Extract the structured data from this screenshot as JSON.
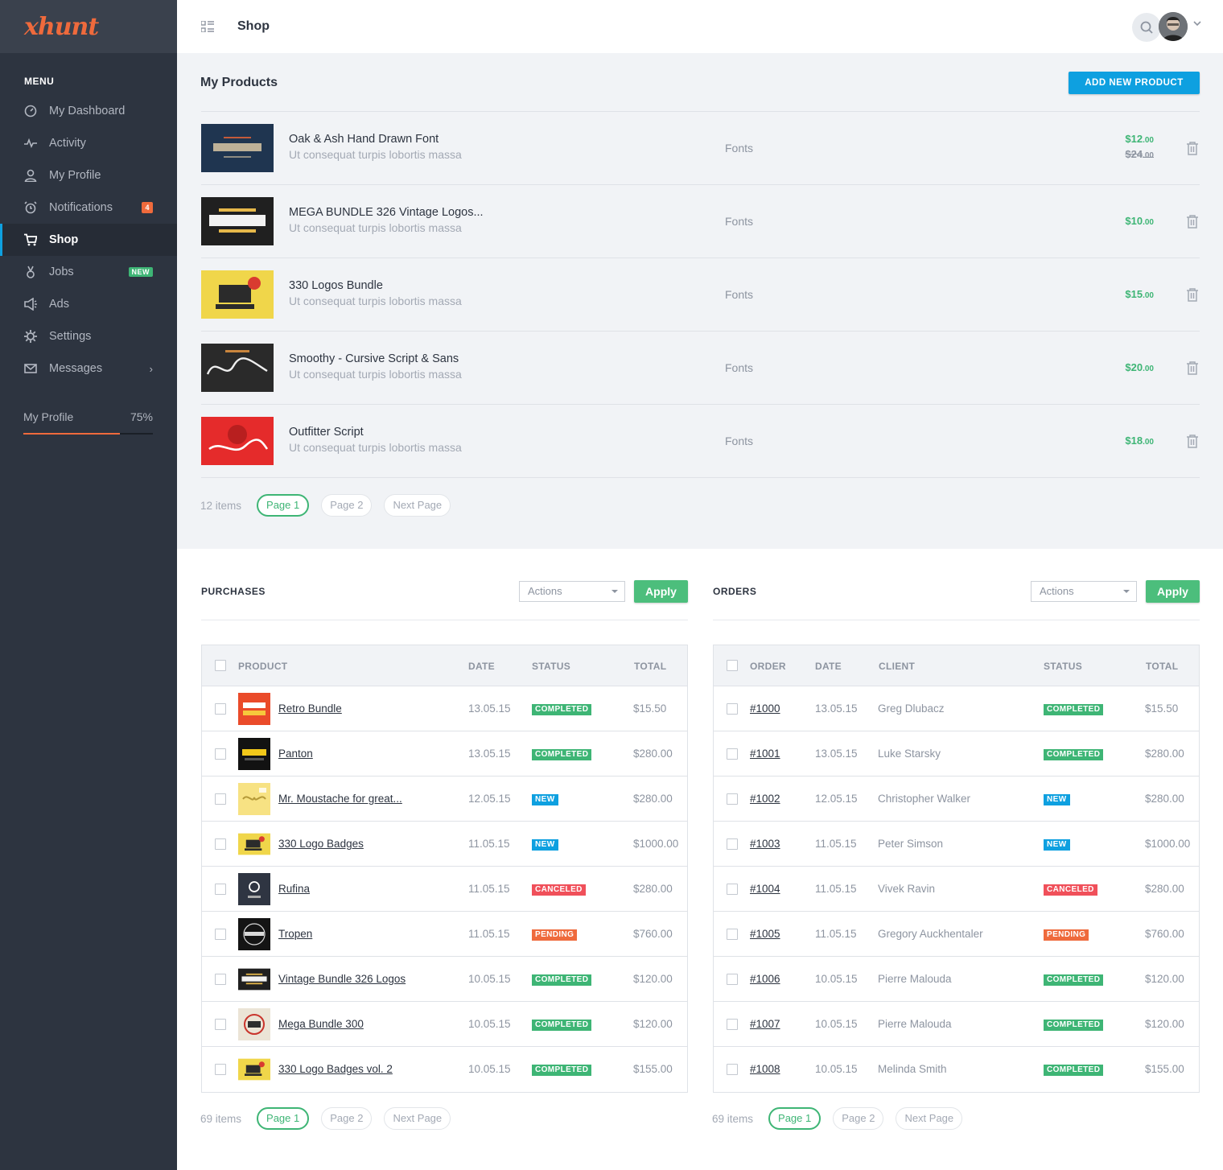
{
  "app": {
    "logo": "xhunt"
  },
  "sidebar": {
    "menu_title": "MENU",
    "items": [
      {
        "label": "My Dashboard",
        "icon": "dashboard-icon"
      },
      {
        "label": "Activity",
        "icon": "activity-icon"
      },
      {
        "label": "My Profile",
        "icon": "user-icon"
      },
      {
        "label": "Notifications",
        "icon": "alarm-icon",
        "badge": "4"
      },
      {
        "label": "Shop",
        "icon": "cart-icon",
        "active": true
      },
      {
        "label": "Jobs",
        "icon": "jobs-icon",
        "badge": "NEW"
      },
      {
        "label": "Ads",
        "icon": "megaphone-icon"
      },
      {
        "label": "Settings",
        "icon": "gear-icon"
      },
      {
        "label": "Messages",
        "icon": "mail-icon"
      }
    ],
    "profile": {
      "label": "My Profile",
      "percent_text": "75%",
      "progress": 0.75
    }
  },
  "header": {
    "title": "Shop"
  },
  "products": {
    "title": "My Products",
    "add_button": "ADD NEW PRODUCT",
    "items": [
      {
        "name": "Oak & Ash Hand Drawn Font",
        "desc": "Ut consequat turpis lobortis massa",
        "category": "Fonts",
        "price_main": "$12",
        "price_cents": ".00",
        "old_main": "$24",
        "old_cents": ".00",
        "thumb": "oak"
      },
      {
        "name": "MEGA BUNDLE 326 Vintage Logos...",
        "desc": "Ut consequat turpis lobortis massa",
        "category": "Fonts",
        "price_main": "$10",
        "price_cents": ".00",
        "thumb": "vintage"
      },
      {
        "name": "330 Logos Bundle",
        "desc": "Ut consequat turpis lobortis massa",
        "category": "Fonts",
        "price_main": "$15",
        "price_cents": ".00",
        "thumb": "330"
      },
      {
        "name": "Smoothy - Cursive Script & Sans",
        "desc": "Ut consequat turpis lobortis massa",
        "category": "Fonts",
        "price_main": "$20",
        "price_cents": ".00",
        "thumb": "smoothy"
      },
      {
        "name": "Outfitter Script",
        "desc": "Ut consequat turpis lobortis massa",
        "category": "Fonts",
        "price_main": "$18",
        "price_cents": ".00",
        "thumb": "outfitter"
      }
    ],
    "pager": {
      "count": "12 items",
      "page1": "Page 1",
      "page2": "Page 2",
      "next": "Next Page"
    }
  },
  "purchases": {
    "title": "PURCHASES",
    "actions": "Actions",
    "apply": "Apply",
    "columns": [
      "PRODUCT",
      "DATE",
      "STATUS",
      "TOTAL"
    ],
    "rows": [
      {
        "product": "Retro Bundle",
        "date": "13.05.15",
        "status": "COMPLETED",
        "total": "$15.50",
        "thumb": "retro"
      },
      {
        "product": "Panton",
        "date": "13.05.15",
        "status": "COMPLETED",
        "total": "$280.00",
        "thumb": "panton"
      },
      {
        "product": "Mr. Moustache for great...",
        "date": "12.05.15",
        "status": "NEW",
        "total": "$280.00",
        "thumb": "moustache"
      },
      {
        "product": "330 Logo Badges",
        "date": "11.05.15",
        "status": "NEW",
        "total": "$1000.00",
        "thumb": "330"
      },
      {
        "product": "Rufina",
        "date": "11.05.15",
        "status": "CANCELED",
        "total": "$280.00",
        "thumb": "rufina"
      },
      {
        "product": "Tropen",
        "date": "11.05.15",
        "status": "PENDING",
        "total": "$760.00",
        "thumb": "tropen"
      },
      {
        "product": "Vintage Bundle 326 Logos",
        "date": "10.05.15",
        "status": "COMPLETED",
        "total": "$120.00",
        "thumb": "vintage"
      },
      {
        "product": "Mega Bundle 300",
        "date": "10.05.15",
        "status": "COMPLETED",
        "total": "$120.00",
        "thumb": "mega300"
      },
      {
        "product": "330 Logo Badges vol. 2",
        "date": "10.05.15",
        "status": "COMPLETED",
        "total": "$155.00",
        "thumb": "330"
      }
    ],
    "pager": {
      "count": "69 items",
      "page1": "Page 1",
      "page2": "Page 2",
      "next": "Next Page"
    }
  },
  "orders": {
    "title": "ORDERS",
    "actions": "Actions",
    "apply": "Apply",
    "columns": [
      "ORDER",
      "DATE",
      "CLIENT",
      "STATUS",
      "TOTAL"
    ],
    "rows": [
      {
        "order": "#1000",
        "date": "13.05.15",
        "client": "Greg Dlubacz",
        "status": "COMPLETED",
        "total": "$15.50"
      },
      {
        "order": "#1001",
        "date": "13.05.15",
        "client": "Luke Starsky",
        "status": "COMPLETED",
        "total": "$280.00"
      },
      {
        "order": "#1002",
        "date": "12.05.15",
        "client": "Christopher Walker",
        "status": "NEW",
        "total": "$280.00"
      },
      {
        "order": "#1003",
        "date": "11.05.15",
        "client": "Peter Simson",
        "status": "NEW",
        "total": "$1000.00"
      },
      {
        "order": "#1004",
        "date": "11.05.15",
        "client": "Vivek Ravin",
        "status": "CANCELED",
        "total": "$280.00"
      },
      {
        "order": "#1005",
        "date": "11.05.15",
        "client": "Gregory Auckhentaler",
        "status": "PENDING",
        "total": "$760.00"
      },
      {
        "order": "#1006",
        "date": "10.05.15",
        "client": "Pierre Malouda",
        "status": "COMPLETED",
        "total": "$120.00"
      },
      {
        "order": "#1007",
        "date": "10.05.15",
        "client": "Pierre Malouda",
        "status": "COMPLETED",
        "total": "$120.00"
      },
      {
        "order": "#1008",
        "date": "10.05.15",
        "client": "Melinda Smith",
        "status": "COMPLETED",
        "total": "$155.00"
      }
    ],
    "pager": {
      "count": "69 items",
      "page1": "Page 1",
      "page2": "Page 2",
      "next": "Next Page"
    }
  },
  "colors": {
    "accent_blue": "#0ea0e0",
    "green": "#3eb575",
    "orange": "#ef6a3c",
    "red": "#f0505a",
    "sidebar": "#2d3440"
  }
}
